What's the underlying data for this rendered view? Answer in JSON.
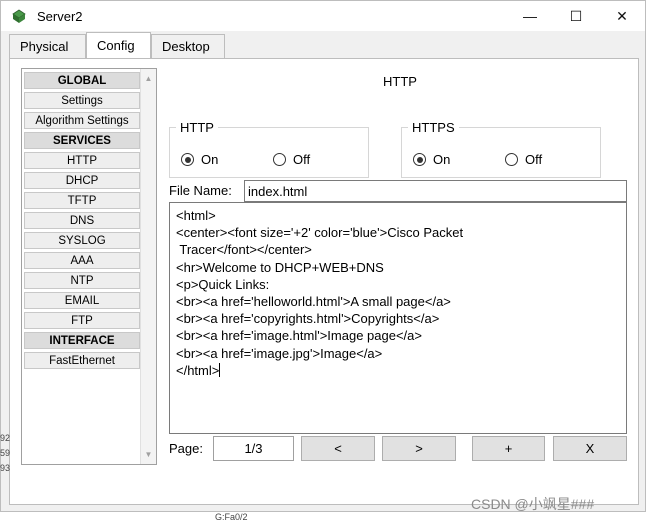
{
  "window": {
    "title": "Server2",
    "icon": "cisco-server-icon"
  },
  "titlebar_buttons": {
    "minimize": "—",
    "maximize": "☐",
    "close": "✕"
  },
  "tabs": [
    {
      "label": "Physical"
    },
    {
      "label": "Config",
      "active": true
    },
    {
      "label": "Desktop"
    }
  ],
  "sidebar": {
    "items": [
      {
        "label": "GLOBAL",
        "header": true
      },
      {
        "label": "Settings"
      },
      {
        "label": "Algorithm Settings"
      },
      {
        "label": "SERVICES",
        "header": true
      },
      {
        "label": "HTTP"
      },
      {
        "label": "DHCP"
      },
      {
        "label": "TFTP"
      },
      {
        "label": "DNS"
      },
      {
        "label": "SYSLOG"
      },
      {
        "label": "AAA"
      },
      {
        "label": "NTP"
      },
      {
        "label": "EMAIL"
      },
      {
        "label": "FTP"
      },
      {
        "label": "INTERFACE",
        "header": true
      },
      {
        "label": "FastEthernet"
      }
    ]
  },
  "panel": {
    "title": "HTTP",
    "http_group": {
      "legend": "HTTP",
      "on_label": "On",
      "off_label": "Off",
      "selected": "On"
    },
    "https_group": {
      "legend": "HTTPS",
      "on_label": "On",
      "off_label": "Off",
      "selected": "On"
    },
    "file_name_label": "File Name:",
    "file_name_value": "index.html",
    "code_lines": [
      "<html>",
      "<center><font size='+2' color='blue'>Cisco Packet",
      " Tracer</font></center>",
      "<hr>Welcome to DHCP+WEB+DNS",
      "<p>Quick Links:",
      "<br><a href='helloworld.html'>A small page</a>",
      "<br><a href='copyrights.html'>Copyrights</a>",
      "<br><a href='image.html'>Image page</a>",
      "<br><a href='image.jpg'>Image</a>",
      "</html>"
    ],
    "page_label": "Page:",
    "page_value": "1/3",
    "buttons": {
      "prev": "<",
      "next": ">",
      "add": "+",
      "remove": "X"
    }
  },
  "background_fragments": {
    "left_digits": [
      "92",
      "59",
      "93"
    ],
    "bottom_label": "G:Fa0/2"
  },
  "watermark": "CSDN @小飒星###"
}
